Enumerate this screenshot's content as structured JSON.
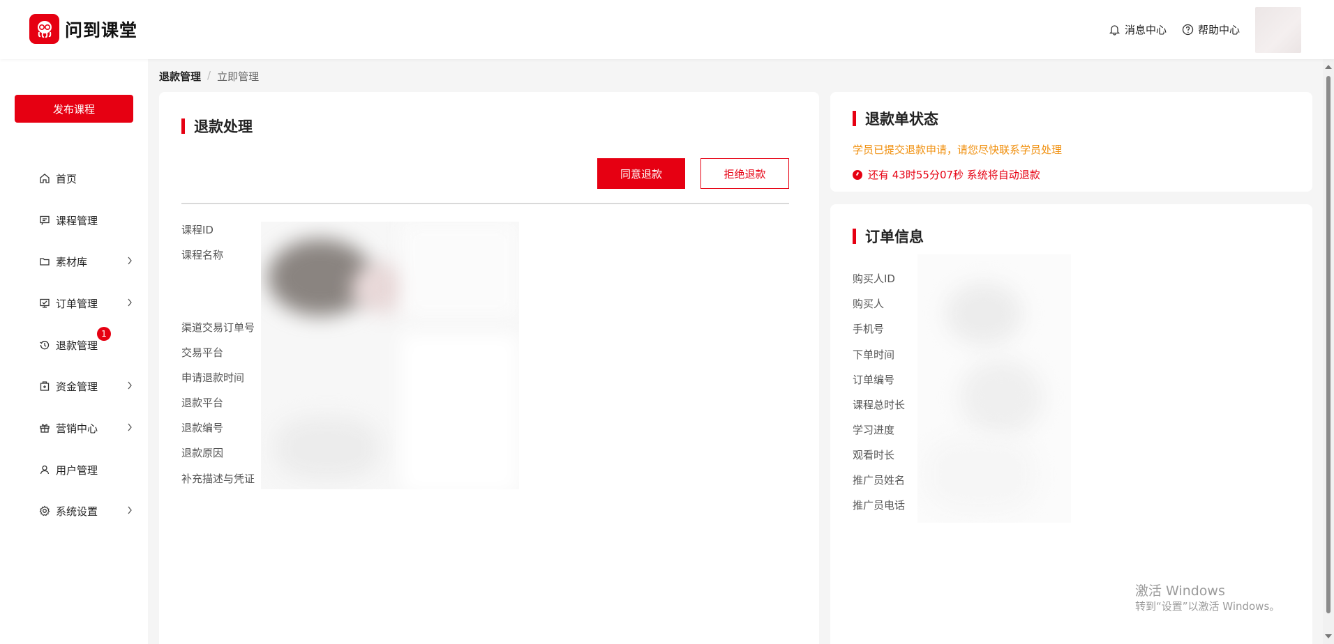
{
  "header": {
    "app_name": "问到课堂",
    "message_center": "消息中心",
    "help_center": "帮助中心"
  },
  "sidebar": {
    "publish_button": "发布课程",
    "items": [
      {
        "label": "首页",
        "icon": "home-icon",
        "has_submenu": false
      },
      {
        "label": "课程管理",
        "icon": "course-icon",
        "has_submenu": false
      },
      {
        "label": "素材库",
        "icon": "folder-icon",
        "has_submenu": true
      },
      {
        "label": "订单管理",
        "icon": "order-icon",
        "has_submenu": true
      },
      {
        "label": "退款管理",
        "icon": "refund-icon",
        "has_submenu": false,
        "badge": "1"
      },
      {
        "label": "资金管理",
        "icon": "wallet-icon",
        "has_submenu": true
      },
      {
        "label": "营销中心",
        "icon": "gift-icon",
        "has_submenu": true
      },
      {
        "label": "用户管理",
        "icon": "user-icon",
        "has_submenu": false
      },
      {
        "label": "系统设置",
        "icon": "gear-icon",
        "has_submenu": true
      }
    ]
  },
  "breadcrumb": {
    "items": [
      "退款管理",
      "立即管理"
    ],
    "separator": "/"
  },
  "refund_card": {
    "title": "退款处理",
    "agree_button": "同意退款",
    "reject_button": "拒绝退款",
    "fields": [
      "课程ID",
      "课程名称",
      "渠道交易订单号",
      "交易平台",
      "申请退款时间",
      "退款平台",
      "退款编号",
      "退款原因",
      "补充描述与凭证"
    ]
  },
  "status_card": {
    "title": "退款单状态",
    "message": "学员已提交退款申请，请您尽快联系学员处理",
    "countdown": "还有 43时55分07秒 系统将自动退款"
  },
  "order_card": {
    "title": "订单信息",
    "fields": [
      "购买人ID",
      "购买人",
      "手机号",
      "下单时间",
      "订单编号",
      "课程总时长",
      "学习进度",
      "观看时长",
      "推广员姓名",
      "推广员电话"
    ]
  },
  "watermark": {
    "line1": "激活 Windows",
    "line2": "转到“设置”以激活 Windows。"
  },
  "colors": {
    "accent": "#e60012",
    "warning": "#f0900f"
  }
}
